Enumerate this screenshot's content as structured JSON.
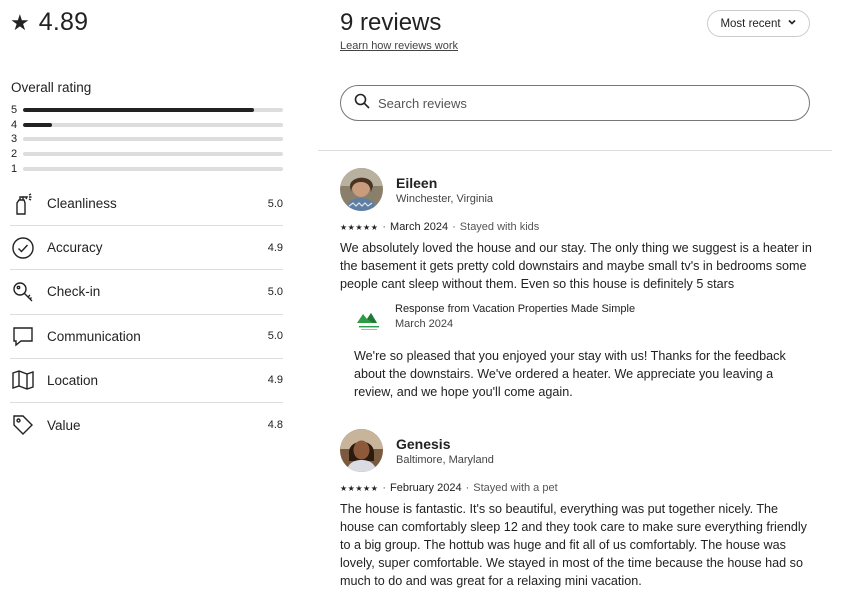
{
  "summary": {
    "score": "4.89",
    "overall_label": "Overall rating",
    "distribution": [
      {
        "stars": "5",
        "fraction": 0.89
      },
      {
        "stars": "4",
        "fraction": 0.11
      },
      {
        "stars": "3",
        "fraction": 0
      },
      {
        "stars": "2",
        "fraction": 0
      },
      {
        "stars": "1",
        "fraction": 0
      }
    ],
    "categories": [
      {
        "icon": "spray-bottle-icon",
        "label": "Cleanliness",
        "value": "5.0"
      },
      {
        "icon": "check-circle-icon",
        "label": "Accuracy",
        "value": "4.9"
      },
      {
        "icon": "key-icon",
        "label": "Check-in",
        "value": "5.0"
      },
      {
        "icon": "chat-bubble-icon",
        "label": "Communication",
        "value": "5.0"
      },
      {
        "icon": "map-icon",
        "label": "Location",
        "value": "4.9"
      },
      {
        "icon": "tag-icon",
        "label": "Value",
        "value": "4.8"
      }
    ]
  },
  "header": {
    "title": "9 reviews",
    "learn_link": "Learn how reviews work",
    "sort_label": "Most recent"
  },
  "search": {
    "placeholder": "Search reviews"
  },
  "reviews": [
    {
      "name": "Eileen",
      "location": "Winchester, Virginia",
      "stars": "★★★★★",
      "date": "March 2024",
      "stay": "Stayed with kids",
      "text": "We absolutely loved the house and our stay. The only thing we suggest is a heater in the basement it gets pretty cold downstairs and maybe small tv's in bedrooms some people cant sleep without them. Even so this house is definitely 5 stars",
      "response": {
        "title": "Response from Vacation Properties Made Simple",
        "date": "March 2024",
        "text": "We're so pleased that you enjoyed your stay with us! Thanks for the feedback about the downstairs. We've ordered a heater. We appreciate you leaving a review, and we hope you'll come again."
      }
    },
    {
      "name": "Genesis",
      "location": "Baltimore, Maryland",
      "stars": "★★★★★",
      "date": "February 2024",
      "stay": "Stayed with a pet",
      "text": "The house is fantastic. It's so beautiful, everything was put together nicely. The house can comfortably sleep 12 and they took care to make sure everything friendly to a big group. The hottub was huge and fit all of us comfortably. The house was lovely, super comfortable. We stayed in most of the time because the house had so much to do and was great for a relaxing mini vacation."
    }
  ],
  "colors": {
    "text": "#222222",
    "muted": "#555555",
    "border": "#dddddd",
    "logo_green": "#2e9b46"
  }
}
